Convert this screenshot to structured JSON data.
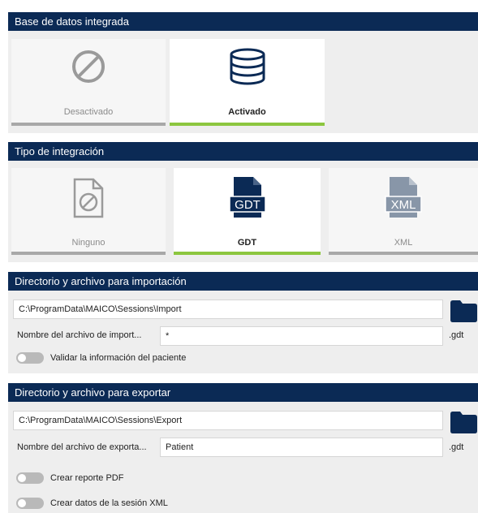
{
  "database": {
    "header": "Base de datos integrada",
    "options": [
      {
        "label": "Desactivado",
        "icon": "prohibited-icon",
        "active": false
      },
      {
        "label": "Activado",
        "icon": "database-icon",
        "active": true
      }
    ]
  },
  "integration": {
    "header": "Tipo de integración",
    "options": [
      {
        "label": "Ninguno",
        "icon": "none-file-icon",
        "active": false
      },
      {
        "label": "GDT",
        "icon": "gdt-file-icon",
        "icon_text": "GDT",
        "active": true
      },
      {
        "label": "XML",
        "icon": "xml-file-icon",
        "icon_text": "XML",
        "active": false
      }
    ]
  },
  "import": {
    "header": "Directorio y archivo para importación",
    "path": "C:\\ProgramData\\MAICO\\Sessions\\Import",
    "filename_label": "Nombre del archivo de import...",
    "filename": "*",
    "extension": ".gdt",
    "toggles": [
      {
        "label": "Validar la información del paciente",
        "on": false
      }
    ]
  },
  "export": {
    "header": "Directorio y archivo para exportar",
    "path": "C:\\ProgramData\\MAICO\\Sessions\\Export",
    "filename_label": "Nombre del archivo de exporta...",
    "filename": "Patient",
    "extension": ".gdt",
    "toggles": [
      {
        "label": "Crear reporte PDF",
        "on": false
      },
      {
        "label": "Crear datos de la sesión XML",
        "on": false
      }
    ]
  },
  "colors": {
    "header_bg": "#0b2a55",
    "active_bar": "#8cc63f",
    "inactive_bar": "#a8a8a8",
    "icon_dark": "#0b2a55",
    "icon_gray": "#9a9a9a",
    "icon_light": "#8896a8"
  }
}
